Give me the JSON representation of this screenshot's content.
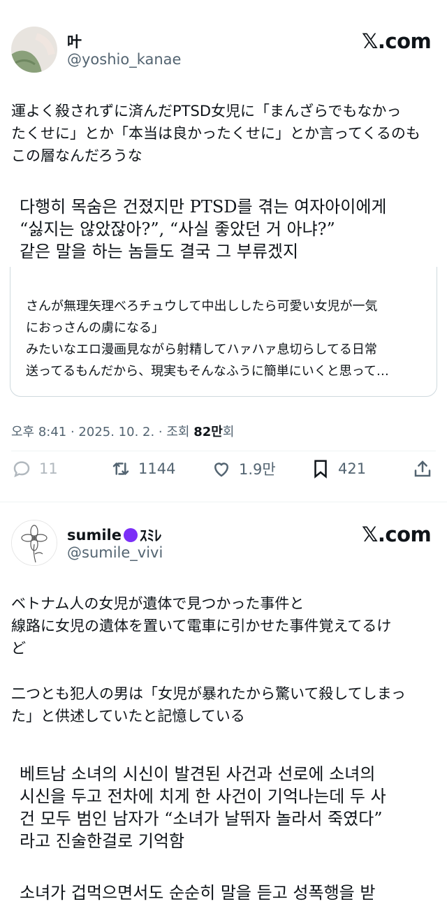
{
  "post1": {
    "author_name": "叶",
    "author_handle": "@yoshio_kanae",
    "brand": "𝕏.com",
    "body_lines": [
      "運よく殺されずに済んだPTSD女児に「まんざらでもなかっ",
      "たくせに」とか「本当は良かったくせに」とか言ってくるのも",
      "この層なんだろうな"
    ],
    "translation_lines": [
      "다행히 목숨은 건졌지만 PTSD를 겪는 여자아이에게",
      "“싫지는 않았잖아?”, “사실 좋았던 거 아냐?”",
      "같은 말을 하는 놈들도 결국 그 부류겠지"
    ],
    "quote_lines": [
      "さんが無理矢理べろチュウして中出ししたら可愛い女児が一気",
      "におっさんの虜になる」",
      "みたいなエロ漫画見ながら射精してハァハァ息切らしてる日常",
      "送ってるもんだから、現実もそんなふうに簡単にいくと思って…"
    ],
    "meta_time": "오후 8:41 · 2025. 10. 2. · 조회 ",
    "meta_views": "82만",
    "meta_suffix": "회",
    "actions": {
      "replies": "11",
      "reposts": "1144",
      "likes": "1.9만",
      "bookmarks": "421"
    }
  },
  "post2": {
    "author_name": "sumile",
    "author_name_suffix": "ｽﾐﾚ",
    "author_handle": "@sumile_vivi",
    "brand": "𝕏.com",
    "body_para1": [
      "ベトナム人の女児が遺体で見つかった事件と",
      "線路に女児の遺体を置いて電車に引かせた事件覚えてるけ",
      "ど"
    ],
    "body_para2": [
      "二つとも犯人の男は「女児が暴れたから驚いて殺してしまっ",
      "た」と供述していたと記憶している"
    ],
    "translation_lines": [
      "베트남 소녀의 시신이 발견된 사건과 선로에 소녀의",
      "시신을 두고 전차에 치게 한 사건이 기억나는데 두 사",
      "건 모두 범인 남자가 “소녀가 날뛰자 놀라서 죽였다”",
      "라고 진술한걸로 기억함"
    ],
    "cutoff_line": "소녀가 겁먹으면서도 순순히 말을 듣고 성폭행을 받"
  },
  "colors": {
    "text": "#0f1419",
    "muted": "#536471",
    "border": "#cfd9de",
    "status_dot": "#7b2ff7"
  }
}
